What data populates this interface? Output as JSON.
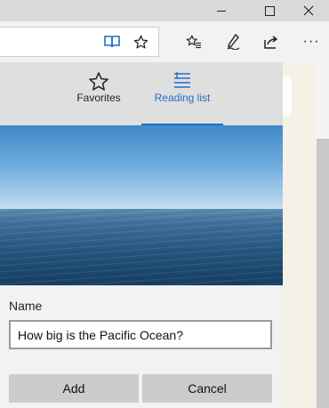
{
  "icons": {
    "minimize": "minimize-icon",
    "maximize": "maximize-icon",
    "close": "close-icon",
    "reading_view": "reading-view-icon",
    "favorite_star": "star-icon",
    "favorites_hub": "favorites-hub-icon",
    "web_note": "pen-icon",
    "share": "share-icon",
    "more": "more-icon"
  },
  "toolbar": {
    "more_label": "···"
  },
  "panel": {
    "tabs": [
      {
        "label": "Favorites",
        "icon": "star-outline-icon",
        "selected": false
      },
      {
        "label": "Reading list",
        "icon": "reading-list-icon",
        "selected": true
      }
    ],
    "form": {
      "name_label": "Name",
      "name_value": "How big is the Pacific Ocean?",
      "add_label": "Add",
      "cancel_label": "Cancel"
    }
  },
  "colors": {
    "accent": "#1f6fc5",
    "button_bg": "#cccccc",
    "panel_bg": "#f2f2f2"
  }
}
